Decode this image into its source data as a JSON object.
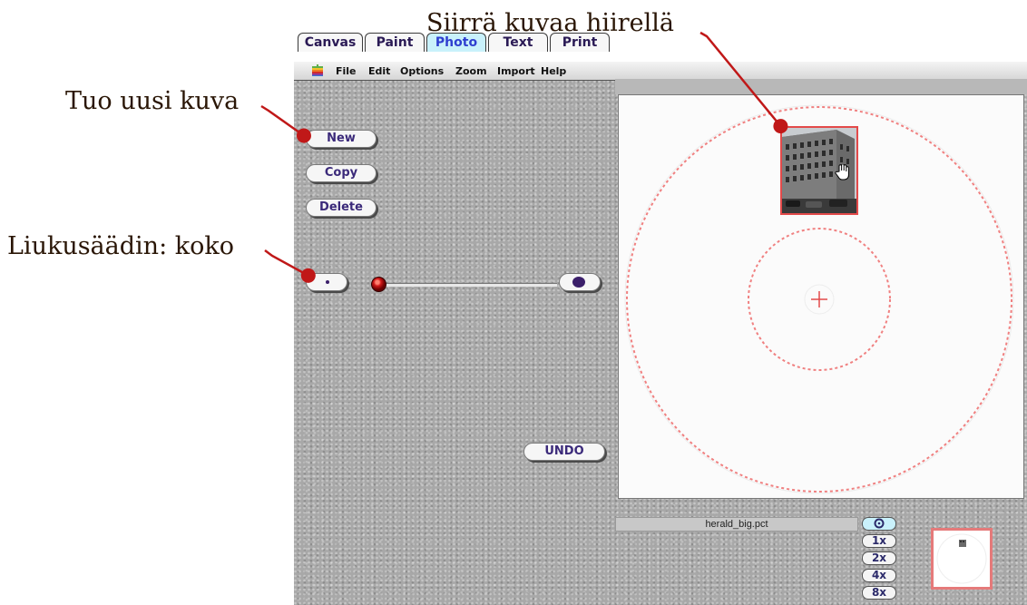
{
  "annotations": {
    "move_image": "Siirrä kuvaa hiirellä",
    "new_image": "Tuo uusi kuva",
    "size_slider": "Liukusäädin: koko"
  },
  "menubar": {
    "items": [
      "File",
      "Edit",
      "Options",
      "Zoom",
      "Import",
      "Help"
    ]
  },
  "tabs": [
    {
      "label": "Canvas",
      "active": false
    },
    {
      "label": "Paint",
      "active": false
    },
    {
      "label": "Photo",
      "active": true
    },
    {
      "label": "Text",
      "active": false
    },
    {
      "label": "Print",
      "active": false
    }
  ],
  "buttons": {
    "new": "New",
    "copy": "Copy",
    "delete": "Delete",
    "undo": "UNDO"
  },
  "status": {
    "filename": "herald_big.pct"
  },
  "zoom": {
    "options": [
      "1x",
      "2x",
      "4x",
      "8x"
    ]
  },
  "colors": {
    "annotation_arrow": "#c01818",
    "guide_circle": "#f08080",
    "active_tab": "#c9f1fb"
  },
  "icons": {
    "menubar": "apple-logo-icon",
    "zoom_toggle": "circle-dot-icon",
    "canvas_center": "crosshair-icon",
    "photo_cursor": "hand-cursor-icon",
    "slider_small": "small-dot-icon",
    "slider_large": "large-dot-icon"
  }
}
